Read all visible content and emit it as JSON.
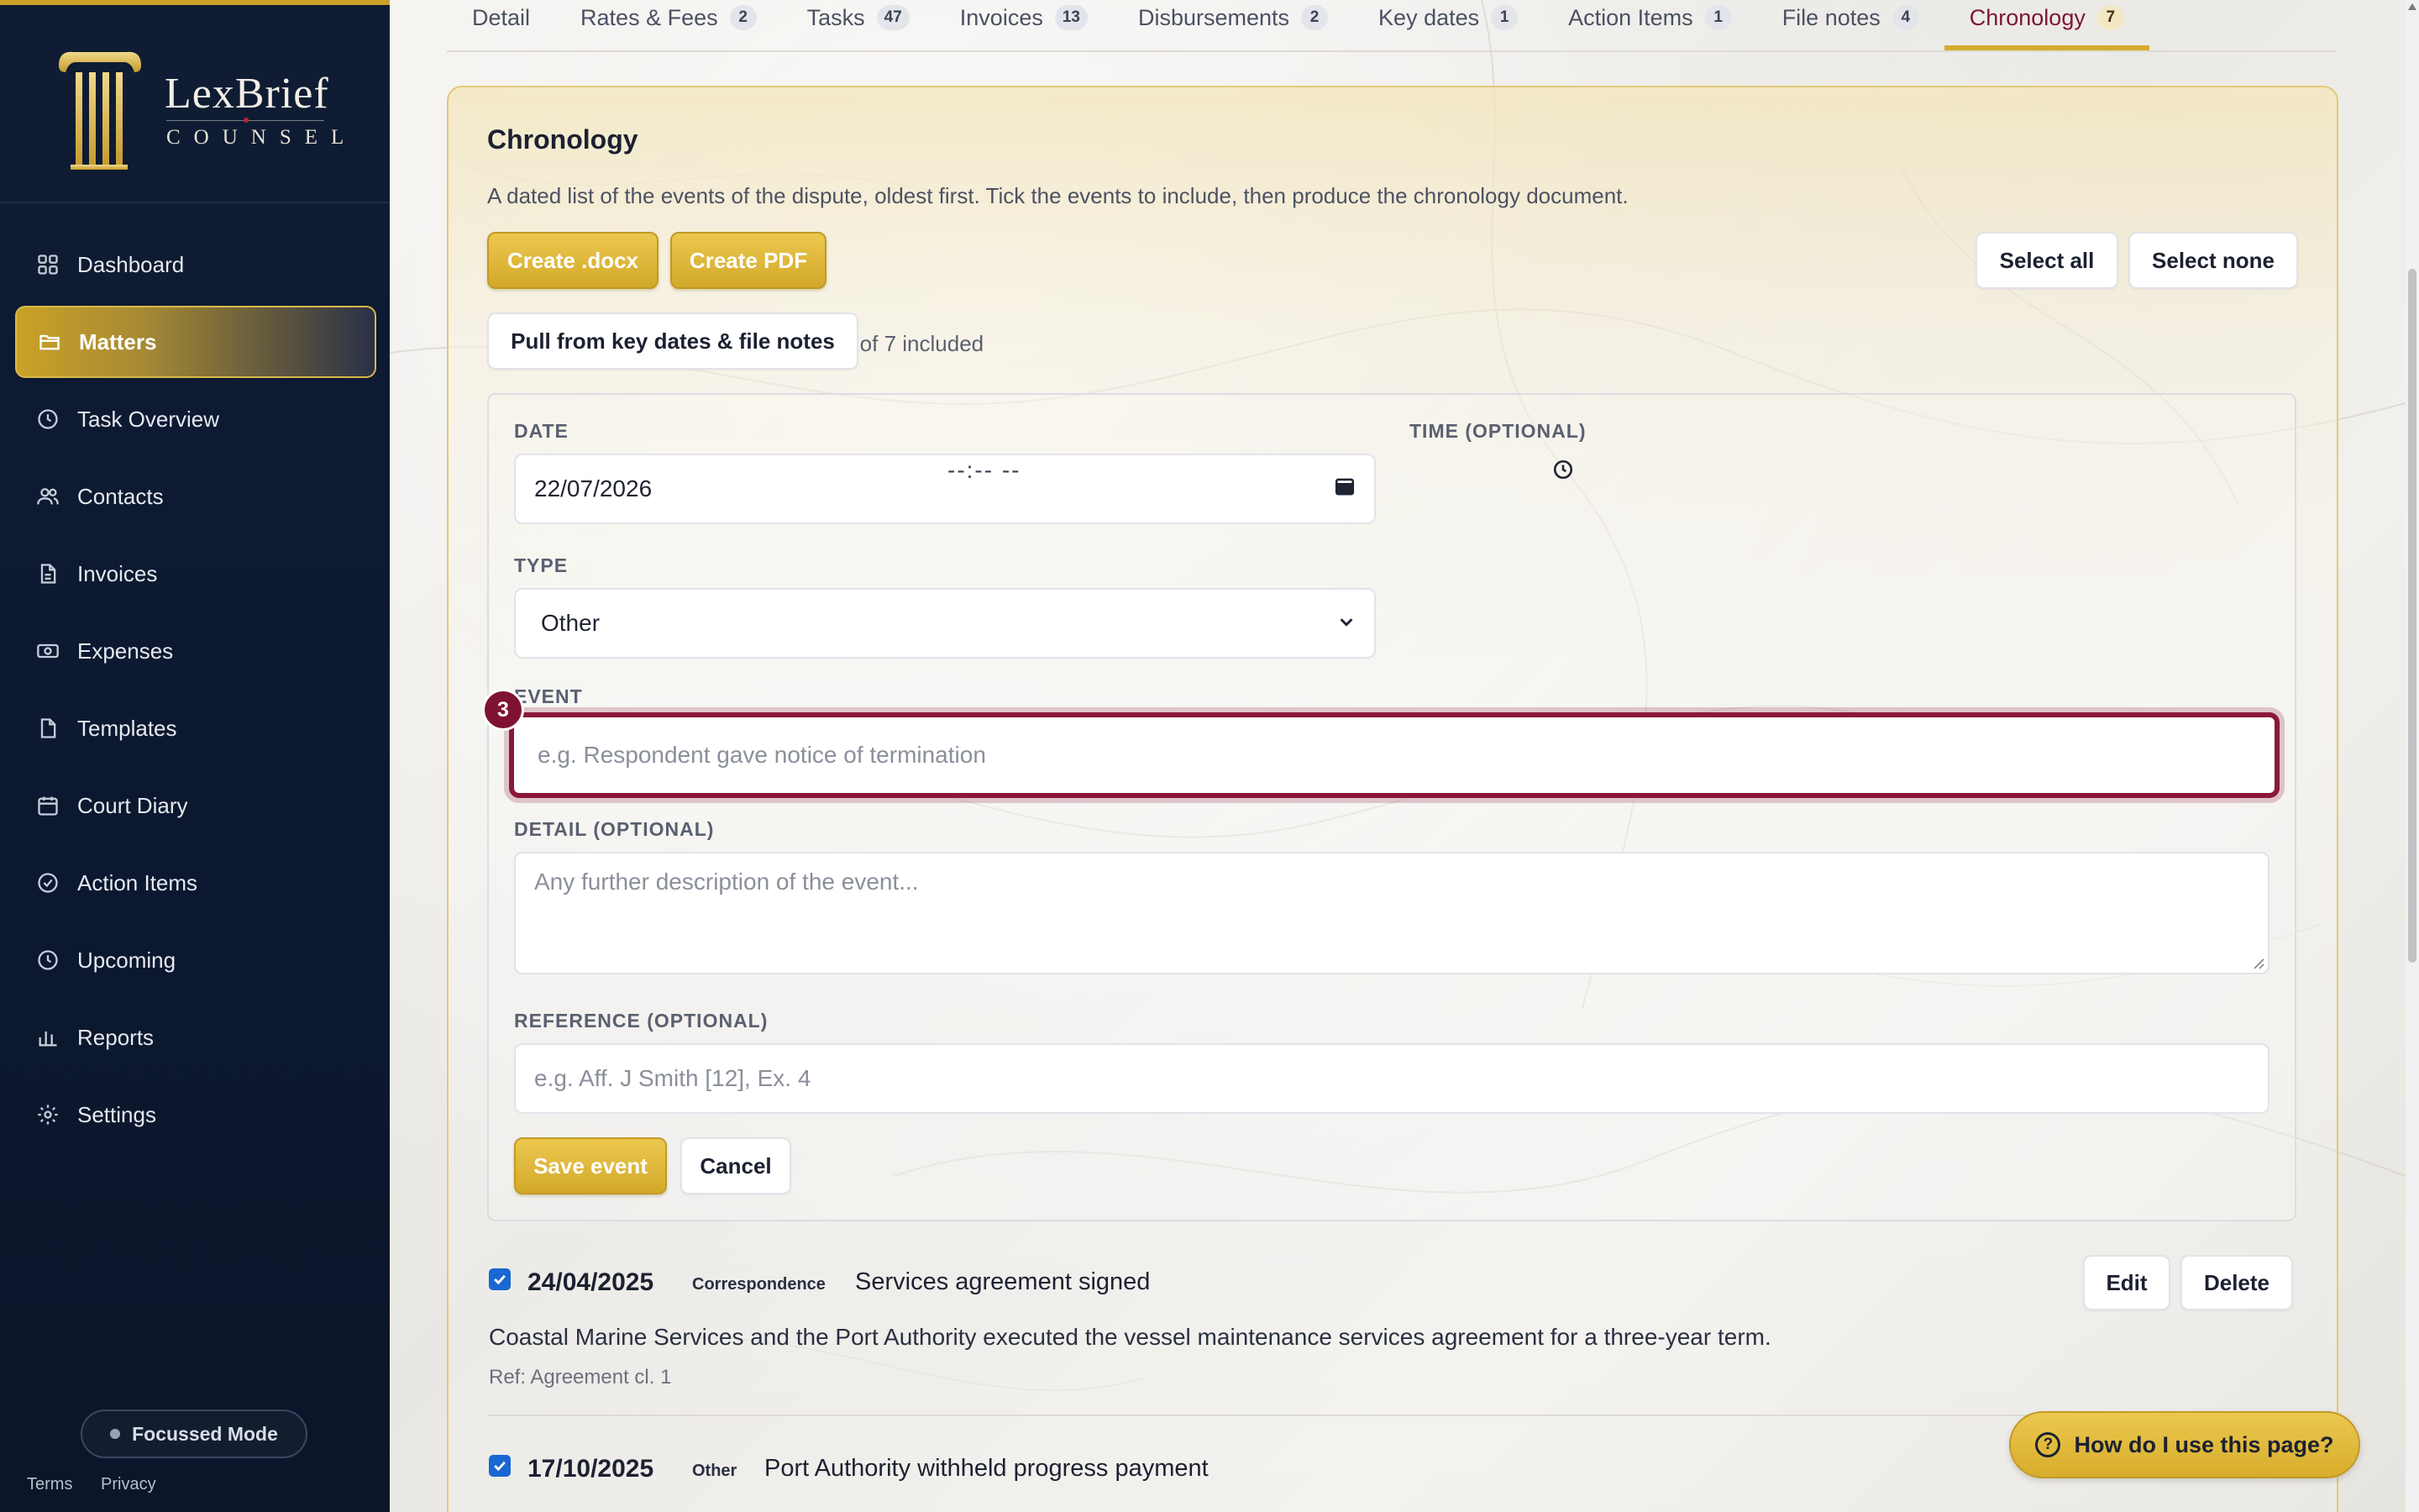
{
  "brand": {
    "name": "LexBrief",
    "sub": "COUNSEL"
  },
  "nav": [
    {
      "label": "Dashboard",
      "icon": "grid-icon"
    },
    {
      "label": "Matters",
      "icon": "folder-icon",
      "active": true
    },
    {
      "label": "Task Overview",
      "icon": "clock-icon"
    },
    {
      "label": "Contacts",
      "icon": "users-icon"
    },
    {
      "label": "Invoices",
      "icon": "document-icon"
    },
    {
      "label": "Expenses",
      "icon": "cash-icon"
    },
    {
      "label": "Templates",
      "icon": "file-icon"
    },
    {
      "label": "Court Diary",
      "icon": "calendar-icon"
    },
    {
      "label": "Action Items",
      "icon": "check-circle-icon"
    },
    {
      "label": "Upcoming",
      "icon": "clock-icon"
    },
    {
      "label": "Reports",
      "icon": "bar-chart-icon"
    },
    {
      "label": "Settings",
      "icon": "gear-icon"
    }
  ],
  "focus_mode": "Focussed Mode",
  "footer": {
    "terms": "Terms",
    "privacy": "Privacy"
  },
  "tabs": [
    {
      "label": "Detail",
      "count": ""
    },
    {
      "label": "Rates & Fees",
      "count": "2"
    },
    {
      "label": "Tasks",
      "count": "47"
    },
    {
      "label": "Invoices",
      "count": "13"
    },
    {
      "label": "Disbursements",
      "count": "2"
    },
    {
      "label": "Key dates",
      "count": "1"
    },
    {
      "label": "Action Items",
      "count": "1"
    },
    {
      "label": "File notes",
      "count": "4"
    },
    {
      "label": "Chronology",
      "count": "7",
      "active": true
    }
  ],
  "chronology": {
    "title": "Chronology",
    "description": "A dated list of the events of the dispute, oldest first. Tick the events to include, then produce the chronology document.",
    "create_docx": "Create .docx",
    "create_pdf": "Create PDF",
    "included": "5 of 7 included",
    "select_all": "Select all",
    "select_none": "Select none",
    "pull": "Pull from key dates & file notes"
  },
  "form": {
    "date_label": "DATE",
    "date_value": "22/07/2026",
    "time_label": "TIME (OPTIONAL)",
    "time_value": "--:-- --",
    "type_label": "TYPE",
    "type_value": "Other",
    "event_label": "EVENT",
    "event_placeholder": "e.g. Respondent gave notice of termination",
    "step": "3",
    "detail_label": "DETAIL (OPTIONAL)",
    "detail_placeholder": "Any further description of the event...",
    "reference_label": "REFERENCE (OPTIONAL)",
    "reference_placeholder": "e.g. Aff. J Smith [12], Ex. 4",
    "save": "Save event",
    "cancel": "Cancel"
  },
  "entries": [
    {
      "checked": true,
      "date": "24/04/2025",
      "type": "Correspondence",
      "title": "Services agreement signed",
      "detail": "Coastal Marine Services and the Port Authority executed the vessel maintenance services agreement for a three-year term.",
      "ref": "Ref: Agreement cl. 1",
      "edit": "Edit",
      "delete": "Delete"
    },
    {
      "checked": true,
      "date": "17/10/2025",
      "type": "Other",
      "title": "Port Authority withheld progress payment"
    }
  ],
  "help": "How do I use this page?",
  "colors": {
    "accent_gold": "#d2a92a",
    "active_tab": "#7a1733",
    "focus_ring": "#8a1838",
    "sidebar_bg": "#0f1c33"
  }
}
